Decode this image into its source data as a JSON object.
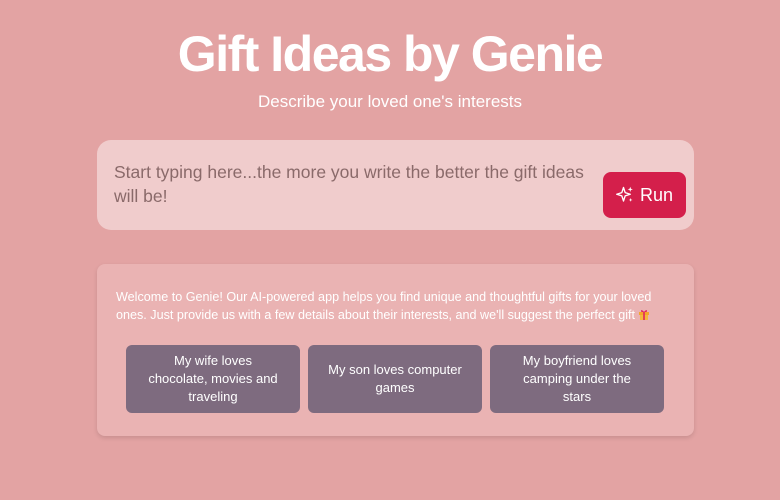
{
  "header": {
    "title": "Gift Ideas by Genie",
    "subtitle": "Describe your loved one's interests"
  },
  "prompt": {
    "placeholder": "Start typing here...the more you write the better the gift ideas will be!",
    "value": "",
    "run_label": "Run",
    "run_icon": "sparkles-icon"
  },
  "welcome": {
    "text": "Welcome to Genie! Our AI-powered app helps you find unique and thoughtful gifts for your loved ones. Just provide us with a few details about their interests, and we'll suggest the perfect gift",
    "emoji": "wrapped-gift-emoji"
  },
  "suggestions": [
    {
      "label": "My wife loves chocolate, movies and traveling"
    },
    {
      "label": "My son loves computer games"
    },
    {
      "label": "My boyfriend loves camping under the stars"
    }
  ],
  "colors": {
    "background": "#e3a3a3",
    "input_card": "#f0cccc",
    "run_button": "#d41f4b",
    "welcome_card": "#eab3b3",
    "suggestion_button": "#7e6b7f"
  }
}
